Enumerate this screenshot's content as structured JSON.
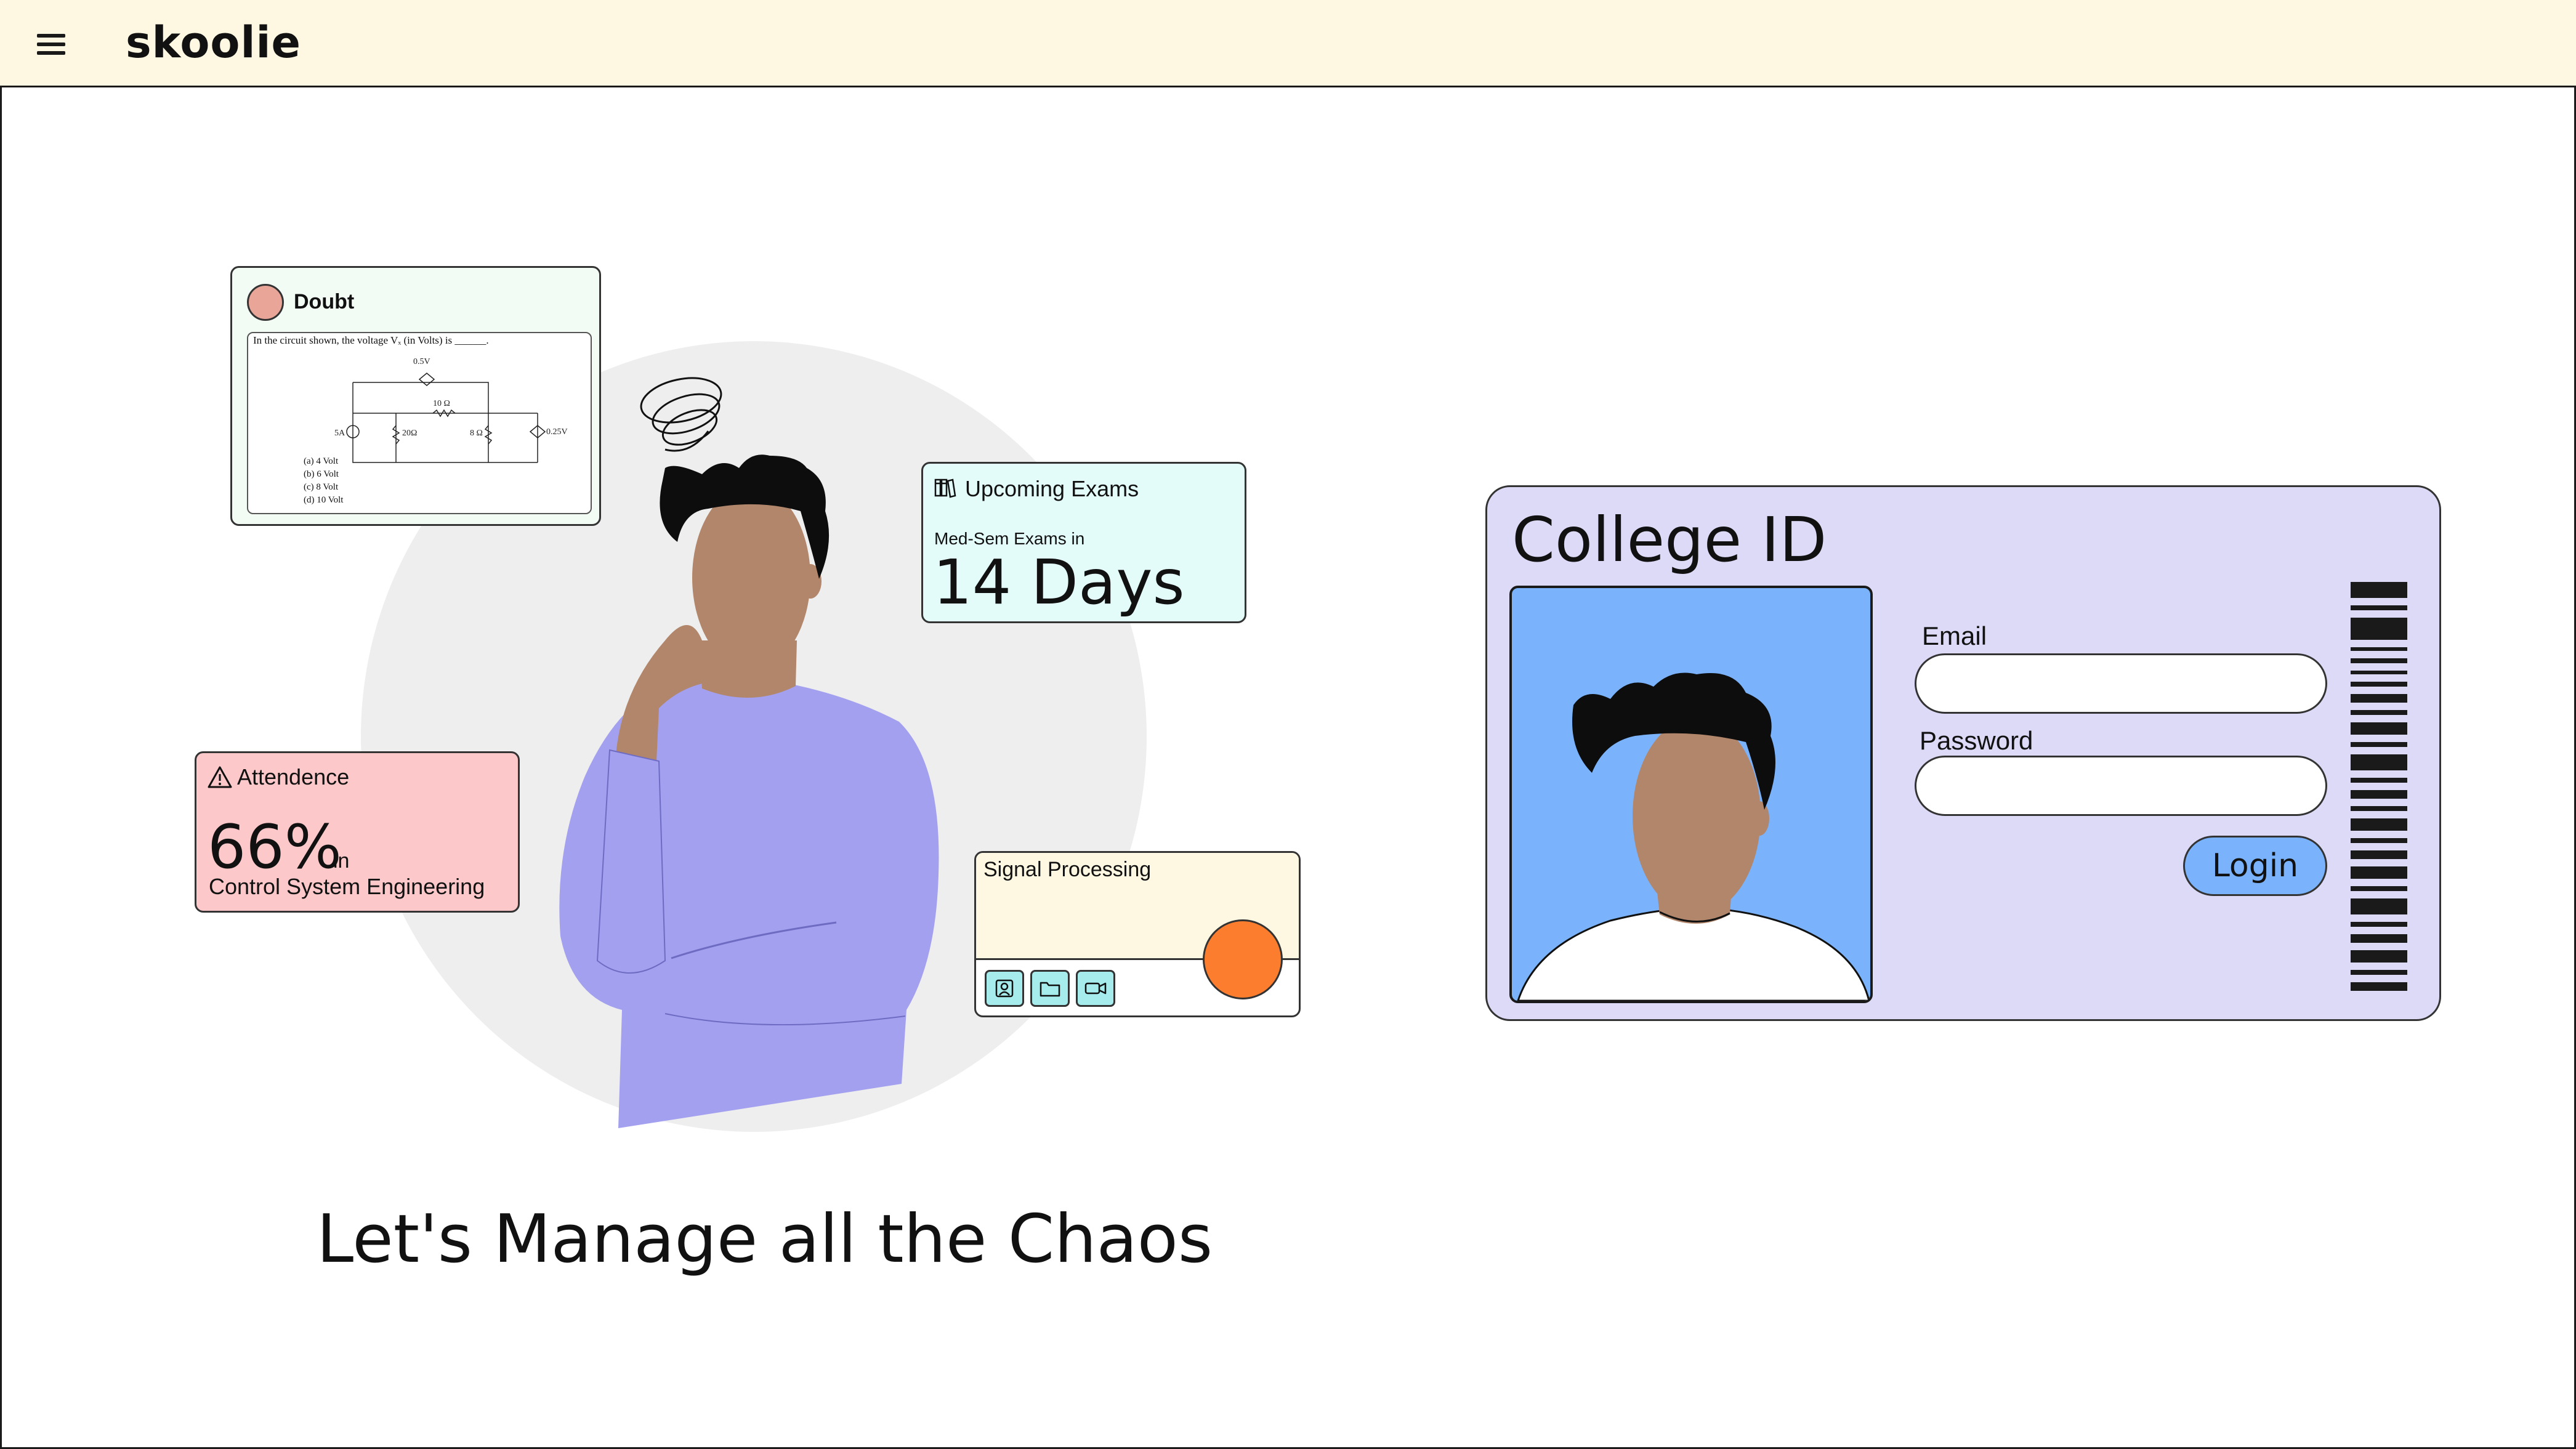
{
  "header": {
    "brand": "skoolie",
    "menu_icon": "hamburger-menu-icon",
    "background": "#fef7e1"
  },
  "doubt_card": {
    "title": "Doubt",
    "question": "In the circuit shown, the voltage Vₓ (in Volts) is ______.",
    "options": [
      "(a) 4 Volt",
      "(b) 6 Volt",
      "(c) 8 Volt",
      "(d) 10 Volt"
    ],
    "background": "#f3fbf5"
  },
  "exam_card": {
    "icon": "books-icon",
    "title": "Upcoming Exams",
    "subtitle": "Med-Sem Exams in",
    "countdown": "14 Days",
    "background": "#e3fcf9"
  },
  "attendance_card": {
    "icon": "warning-triangle-icon",
    "title": "Attendence",
    "percent": "66%",
    "in_word": "in",
    "subject": "Control System Engineering",
    "background": "#fdc8c9"
  },
  "signal_card": {
    "title": "Signal Processing",
    "buttons": [
      "contact-icon",
      "folder-icon",
      "video-camera-icon"
    ],
    "accent": "#fb7d2d"
  },
  "tagline": "Let's Manage all the Chaos",
  "college_id": {
    "title": "College ID",
    "email_label": "Email",
    "email_value": "",
    "password_label": "Password",
    "password_value": "",
    "login_label": "Login",
    "card_background": "#dcdaf7",
    "photo_background": "#7ab3fb"
  },
  "colors": {
    "figure_shirt": "#a3a0ef",
    "skin": "#b2866b",
    "hair": "#0d0d0d",
    "backdrop_circle": "#eeeeee"
  }
}
